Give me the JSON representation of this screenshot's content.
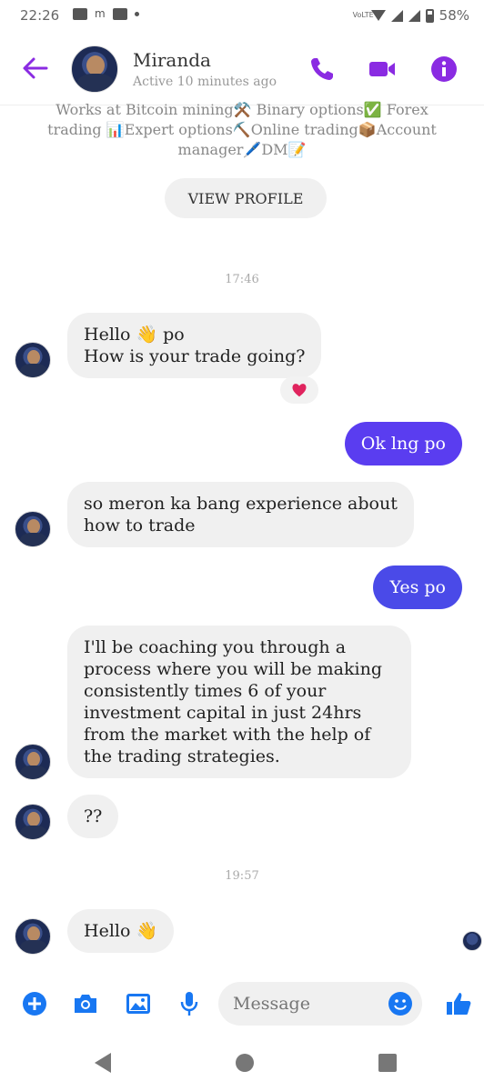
{
  "status_bar": {
    "time": "22:26",
    "notif_letter": "m",
    "volte": "VoLTE",
    "battery": "58%"
  },
  "header": {
    "name": "Miranda",
    "status": "Active 10 minutes ago"
  },
  "profile": {
    "bio": "Works at Bitcoin mining⚒️ Binary options✅ Forex trading 📊Expert options⛏️Online trading📦Account manager🖊️DM📝",
    "view_profile_label": "VIEW PROFILE"
  },
  "timestamps": [
    "17:46",
    "19:57"
  ],
  "messages": [
    {
      "sender": "Miranda",
      "lines": [
        "Hello 👋 po",
        "How is your trade going?"
      ],
      "reaction": "❤️"
    },
    {
      "sender": "me",
      "lines": [
        "Ok lng po"
      ]
    },
    {
      "sender": "Miranda",
      "lines": [
        "so meron ka bang experience about",
        "how to trade"
      ]
    },
    {
      "sender": "me",
      "lines": [
        "Yes po"
      ]
    },
    {
      "sender": "Miranda",
      "lines": [
        "I'll be coaching you through a",
        "process where you will be making",
        "consistently times 6 of your",
        "investment capital in just 24hrs",
        "from the market with the help of",
        "the trading strategies."
      ]
    },
    {
      "sender": "Miranda",
      "lines": [
        "??"
      ]
    },
    {
      "sender": "Miranda",
      "lines": [
        "Hello 👋"
      ]
    }
  ],
  "composer": {
    "placeholder": "Message"
  },
  "colors": {
    "accent": "#8a2be2",
    "outgoing_bubble": "#5a3df0",
    "blue_icons": "#1877f2"
  }
}
